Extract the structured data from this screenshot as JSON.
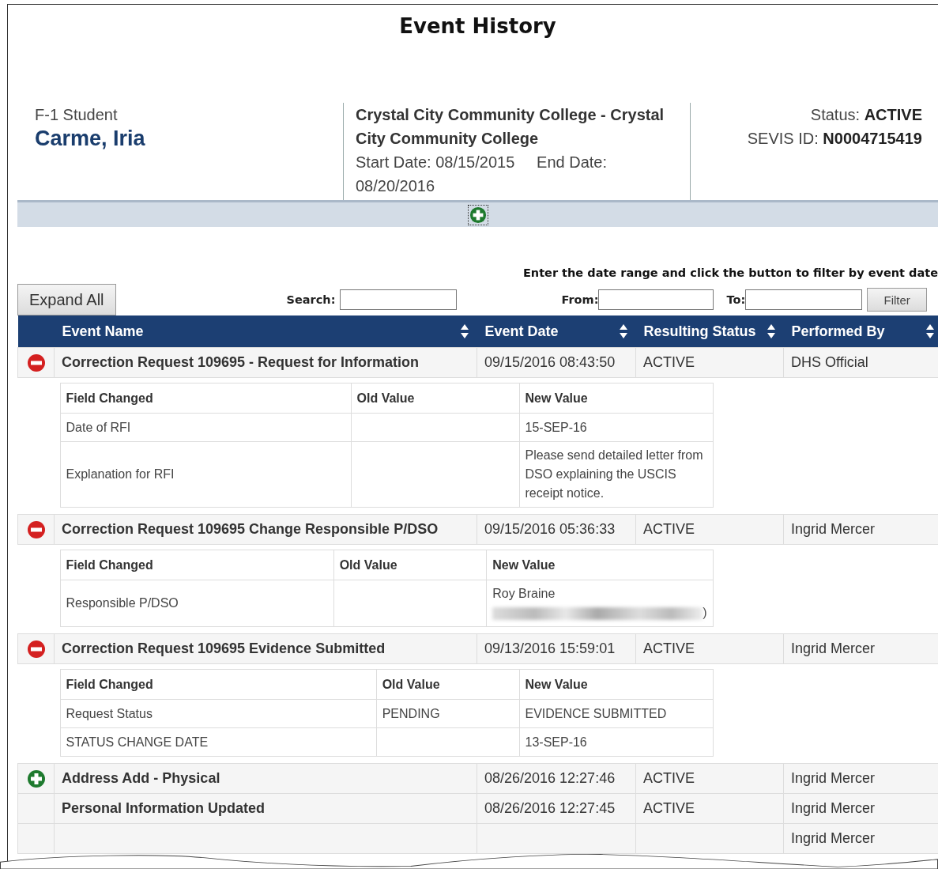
{
  "title": "Event History",
  "student": {
    "type": "F-1 Student",
    "name": "Carme, Iria"
  },
  "school": {
    "name": "Crystal City Community College - Crystal City Community College",
    "start_label": "Start Date:",
    "start": "08/15/2015",
    "end_label": "End Date:",
    "end": "08/20/2016"
  },
  "status": {
    "label": "Status:",
    "value": "ACTIVE"
  },
  "sevis": {
    "label": "SEVIS ID:",
    "value": "N0004715419"
  },
  "details_expanded": false,
  "filter": {
    "hint": "Enter the date range and click the button to filter by event date",
    "expand_all": "Expand All",
    "search_label": "Search:",
    "from_label": "From:",
    "to_label": "To:",
    "button": "Filter"
  },
  "columns": [
    "Event Name",
    "Event Date",
    "Resulting Status",
    "Performed By"
  ],
  "events": [
    {
      "expanded": true,
      "name": "Correction Request 109695 - Request for Information",
      "date": "09/15/2016 08:43:50",
      "status": "ACTIVE",
      "performer": "DHS Official",
      "changes": {
        "columns": [
          "Field Changed",
          "Old Value",
          "New Value"
        ],
        "rows": [
          {
            "field": "Date of RFI",
            "new": "15-SEP-16"
          },
          {
            "field": "Explanation for RFI",
            "new": "Please send detailed letter from DSO explaining the USCIS receipt notice."
          }
        ]
      }
    },
    {
      "expanded": true,
      "name": "Correction Request 109695 Change Responsible P/DSO",
      "date": "09/15/2016 05:36:33",
      "status": "ACTIVE",
      "performer": "Ingrid Mercer",
      "changes": {
        "columns": [
          "Field Changed",
          "Old Value",
          "New Value"
        ],
        "rows": [
          {
            "field": "Responsible P/DSO",
            "new": "Roy Braine",
            "redacted_tail": ")"
          }
        ]
      }
    },
    {
      "expanded": true,
      "name": "Correction Request 109695 Evidence Submitted",
      "date": "09/13/2016 15:59:01",
      "status": "ACTIVE",
      "performer": "Ingrid Mercer",
      "changes": {
        "columns": [
          "Field Changed",
          "Old Value",
          "New Value"
        ],
        "rows": [
          {
            "field": "Request Status",
            "old": "PENDING",
            "new": "EVIDENCE SUBMITTED"
          },
          {
            "field": "STATUS CHANGE DATE",
            "new": "13-SEP-16"
          }
        ]
      }
    },
    {
      "expanded": false,
      "name": "Address Add - Physical",
      "date": "08/26/2016 12:27:46",
      "status": "ACTIVE",
      "performer": "Ingrid Mercer"
    },
    {
      "name": "Personal Information Updated",
      "date": "08/26/2016 12:27:45",
      "status": "ACTIVE",
      "performer": "Ingrid Mercer"
    },
    {
      "performer": "Ingrid Mercer"
    }
  ]
}
